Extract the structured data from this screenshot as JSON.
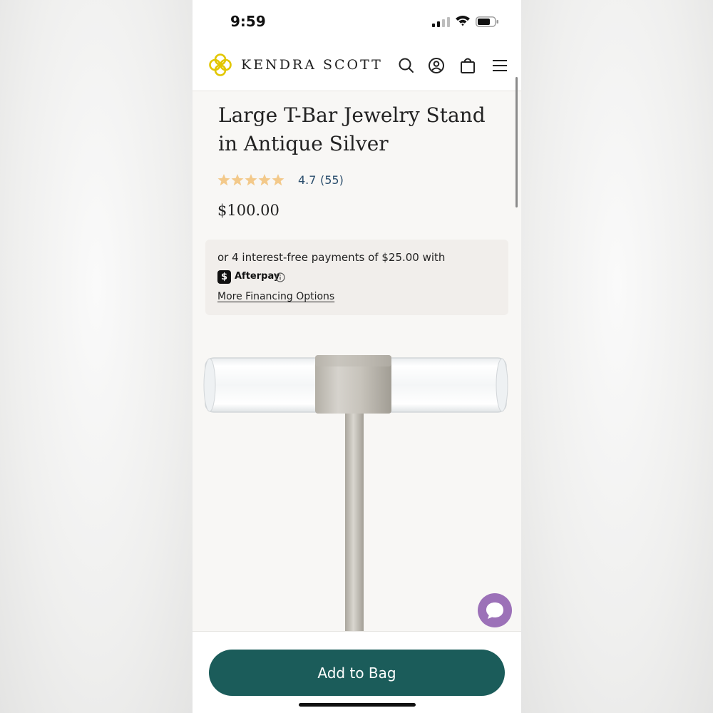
{
  "status_bar": {
    "time": "9:59"
  },
  "header": {
    "brand": "KENDRA SCOTT",
    "icons": [
      "search-icon",
      "account-icon",
      "bag-icon",
      "menu-icon"
    ]
  },
  "product": {
    "title": "Large T-Bar Jewelry Stand in Antique Silver",
    "rating": "4.7",
    "review_count": "(55)",
    "stars": 5,
    "price": "$100.00"
  },
  "financing": {
    "installments_text": "or 4 interest-free payments of $25.00 with",
    "provider": "Afterpay",
    "more_link": "More Financing Options"
  },
  "cta": {
    "add_to_bag": "Add to Bag"
  },
  "colors": {
    "accent": "#1b5c5a",
    "logo_gold": "#e2c600",
    "star": "#f3c98a",
    "link": "#2c4f6d",
    "chat": "#9c71b8"
  }
}
